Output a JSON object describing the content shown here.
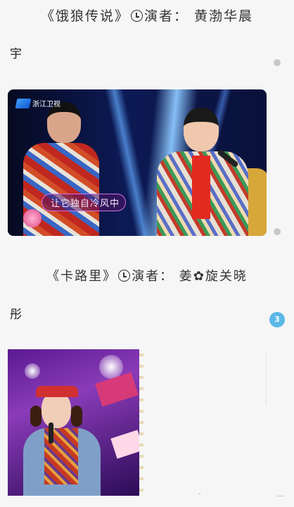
{
  "headline_1": {
    "before_icon": "《饿狼传说》",
    "after_icon": "演者： 黄渤华晨",
    "icon": "clock-icon"
  },
  "char_1": "宇",
  "headline_2": {
    "before_icon": "《卡路里》",
    "after_icon": "演者： 姜",
    "emoji": "✿",
    "after_emoji": "旋关晓"
  },
  "char_2": "彤",
  "video_1": {
    "channel_logo_text": "浙江卫视",
    "subtitle": "让它独自冷风中"
  },
  "comment_count": "3",
  "colors": {
    "page_background": "#f6f6f6",
    "badge_blue": "#5ab8e8",
    "subtitle_border": "#d36fe6"
  }
}
